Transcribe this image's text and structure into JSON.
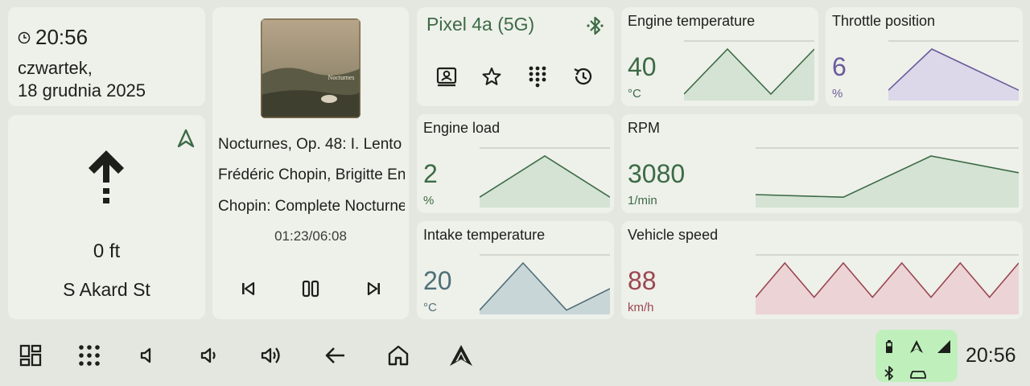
{
  "clock": {
    "time": "20:56",
    "date_line1": "czwartek,",
    "date_line2": "18 grudnia 2025"
  },
  "navigation": {
    "distance": "0 ft",
    "street": "S Akard St",
    "maneuver_icon": "straight-arrow-icon",
    "mode_icon": "navigation-arrow-icon"
  },
  "media": {
    "album_art_text": "Nocturnes",
    "title": "Nocturnes, Op. 48: I. Lento",
    "artist": "Frédéric Chopin, Brigitte Engerer",
    "album": "Chopin: Complete Nocturnes",
    "progress": "01:23/06:08",
    "buttons": [
      "previous-icon",
      "pause-icon",
      "next-icon"
    ]
  },
  "phone": {
    "device_name": "Pixel 4a (5G)",
    "buttons": [
      "contacts-icon",
      "favorites-icon",
      "dialpad-icon",
      "history-icon"
    ]
  },
  "metrics": [
    {
      "title": "Engine temperature",
      "value": "40",
      "unit": "°C",
      "color": "#3c6b45",
      "fill": "#d4e3d4",
      "points": [
        5,
        40,
        5,
        40
      ]
    },
    {
      "title": "Throttle position",
      "value": "6",
      "unit": "%",
      "color": "#6b5b9a",
      "fill": "#dcd8ea",
      "points": [
        5,
        25,
        15,
        5
      ]
    },
    {
      "title": "Engine load",
      "value": "2",
      "unit": "%",
      "color": "#3c6b45",
      "fill": "#d4e3d4",
      "points": [
        5,
        25,
        5
      ]
    },
    {
      "title": "RPM",
      "value": "3080",
      "unit": "1/min",
      "color": "#3c6b45",
      "fill": "#d4e3d4",
      "points": [
        10,
        8,
        40,
        27
      ]
    },
    {
      "title": "Intake temperature",
      "value": "20",
      "unit": "°C",
      "color": "#4f6f78",
      "fill": "#c9d6d8",
      "points": [
        5,
        60,
        5,
        30
      ]
    },
    {
      "title": "Vehicle speed",
      "value": "88",
      "unit": "km/h",
      "color": "#9b4750",
      "fill": "#ecd4d6",
      "points": [
        5,
        15,
        5,
        15,
        5,
        15,
        5,
        15,
        5,
        15
      ]
    }
  ],
  "bottom_bar": {
    "buttons": [
      "dashboard-icon",
      "app-grid-icon",
      "volume-mute-icon",
      "volume-down-icon",
      "volume-up-icon",
      "back-icon",
      "home-icon",
      "android-auto-icon"
    ],
    "time": "20:56"
  },
  "status": {
    "icons": [
      "battery-icon",
      "android-auto-icon",
      "signal-icon",
      "bluetooth-icon",
      "car-icon"
    ]
  },
  "colors": {
    "background": "#e4e7e0",
    "card": "#eef0ea",
    "accent": "#3c6b45",
    "status_bg": "#bff0bc"
  }
}
